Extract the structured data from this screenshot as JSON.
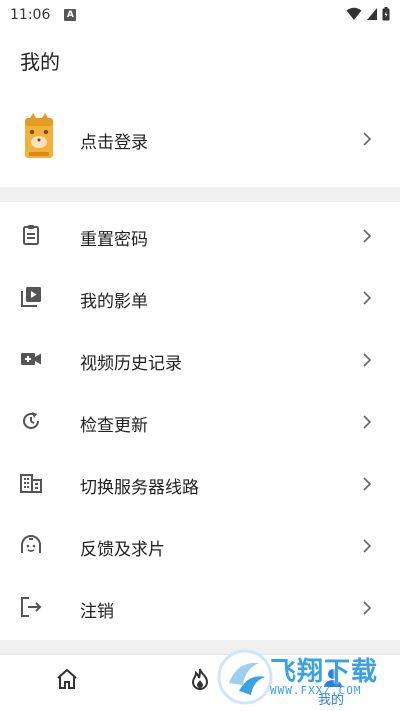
{
  "status_bar": {
    "time": "11:06",
    "indicator": "A"
  },
  "header": {
    "title": "我的"
  },
  "profile": {
    "login_label": "点击登录"
  },
  "menu": [
    {
      "label": "重置密码",
      "icon": "clipboard-icon"
    },
    {
      "label": "我的影单",
      "icon": "playlist-icon"
    },
    {
      "label": "视频历史记录",
      "icon": "video-history-icon"
    },
    {
      "label": "检查更新",
      "icon": "refresh-icon"
    },
    {
      "label": "切换服务器线路",
      "icon": "server-building-icon"
    },
    {
      "label": "反馈及求片",
      "icon": "feedback-icon"
    },
    {
      "label": "注销",
      "icon": "logout-icon"
    }
  ],
  "bottom_nav": {
    "mine_label": "我的",
    "active": "mine",
    "accent": "#2a7fe0"
  },
  "watermark": {
    "text": "飞翔下载",
    "url": "WWW.FXXZ.COM"
  },
  "colors": {
    "divider": "#f0f0f0",
    "icon_gray": "#555555",
    "accent": "#2a7fe0"
  }
}
